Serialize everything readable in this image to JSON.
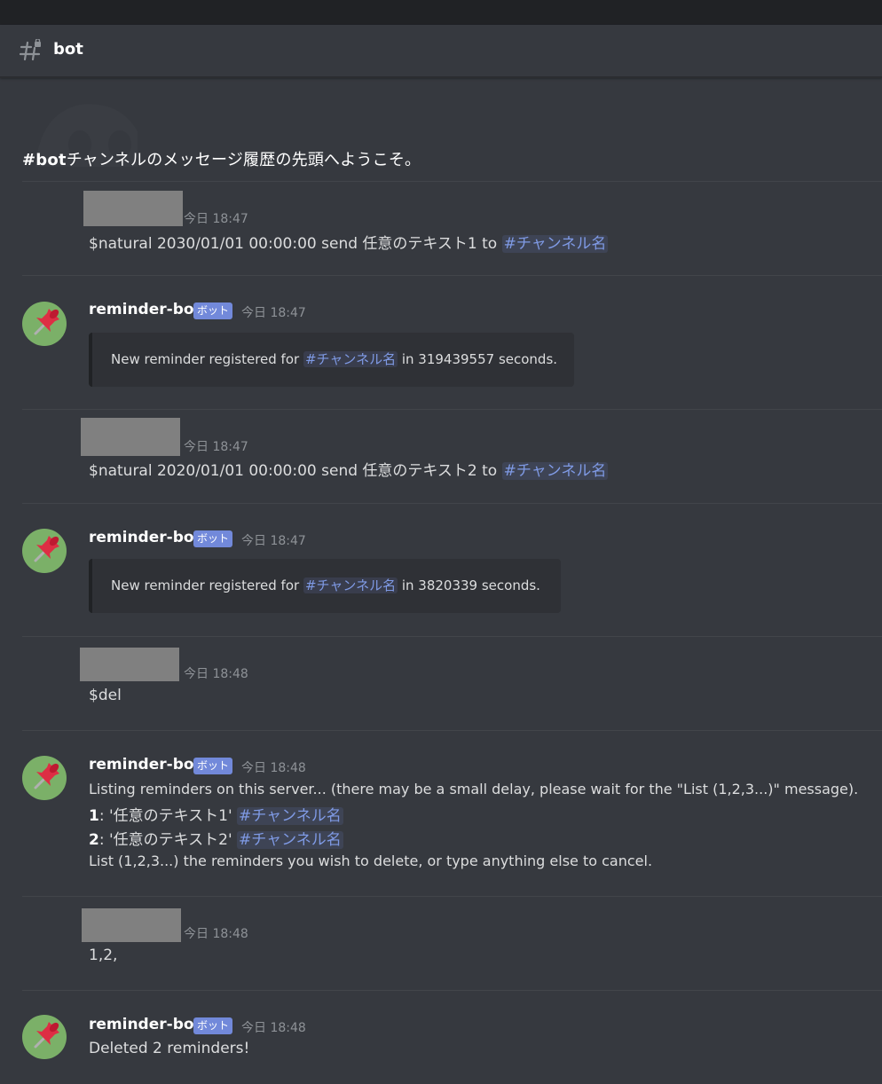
{
  "channel": {
    "name": "bot",
    "welcome_bold": "#bot",
    "welcome_rest": "チャンネルのメッセージ履歴の先頭へようこそ。"
  },
  "bot": {
    "name": "reminder-bot",
    "badge": "ボット"
  },
  "mention_label": "#チャンネル名",
  "messages": [
    {
      "ts": "今日 18:47",
      "text": "$natural 2030/01/01 00:00:00 send 任意のテキスト1 to "
    },
    {
      "ts": "今日 18:47",
      "embed_pre": "New reminder registered for ",
      "embed_post": " in 319439557 seconds."
    },
    {
      "ts": "今日 18:47",
      "text": "$natural 2020/01/01 00:00:00 send 任意のテキスト2 to "
    },
    {
      "ts": "今日 18:47",
      "embed_pre": "New reminder registered for ",
      "embed_post": " in 3820339 seconds."
    },
    {
      "ts": "今日 18:48",
      "text": "$del"
    },
    {
      "ts": "今日 18:48",
      "line1": "Listing reminders on this server... (there may be a small delay, please wait for the \"List (1,2,3...)\" message).",
      "item1_num": "1",
      "item1_text": ": '任意のテキスト1' ",
      "item2_num": "2",
      "item2_text": ": '任意のテキスト2' ",
      "line4": "List (1,2,3...) the reminders you wish to delete, or type anything else to cancel."
    },
    {
      "ts": "今日 18:48",
      "text": "1,2,"
    },
    {
      "ts": "今日 18:48",
      "text": "Deleted 2 reminders!"
    }
  ],
  "colors": {
    "background": "#36393f",
    "mention": "#7f9ae5",
    "bot_badge": "#7289da",
    "avatar": "#7bb068",
    "pin": "#dd2e44"
  },
  "icons": [
    "channel-hash-icon",
    "discord-logo-watermark",
    "pushpin-avatar-icon"
  ]
}
